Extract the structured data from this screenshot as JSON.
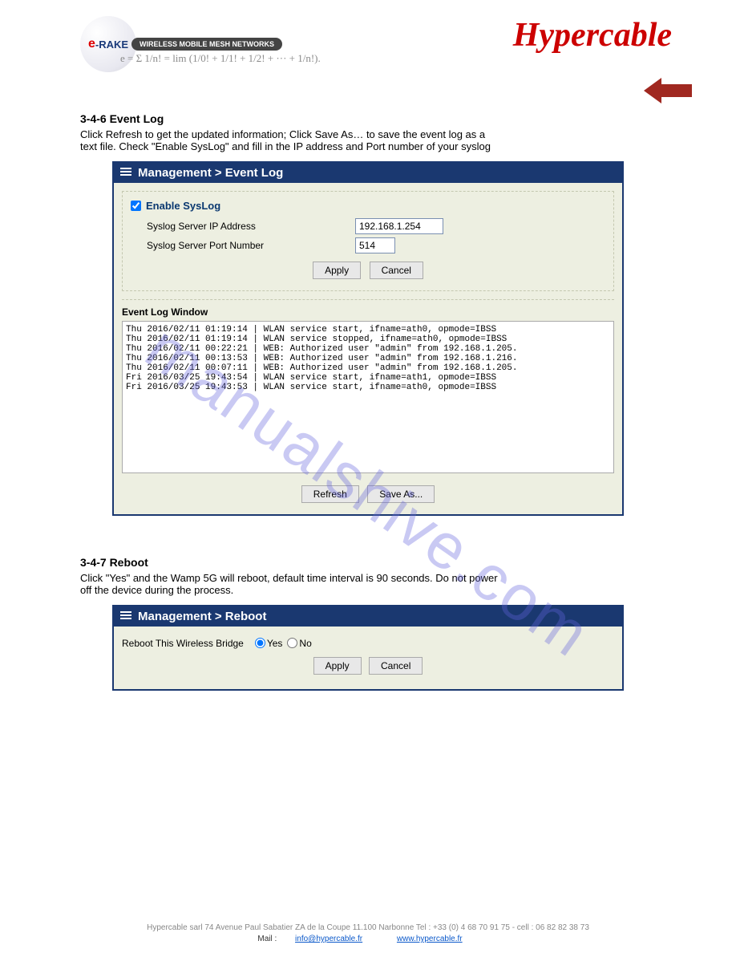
{
  "watermark": "manualshive.com",
  "header": {
    "erake": {
      "e": "e",
      "rake": "-RAKE",
      "tagline": "WIRELESS MOBILE MESH NETWORKS"
    },
    "formula": "e = Σ 1/n! = lim (1/0! + 1/1! + 1/2! + ··· + 1/n!).",
    "hypercable": "Hypercable"
  },
  "sections": {
    "event_log": {
      "heading": "3-4-6 Event Log",
      "desc1": "Click Refresh to get the updated information; Click Save As… to save the event log as a",
      "desc2": "text file. Check \"Enable SysLog\" and fill in the IP address and Port number of your syslog"
    },
    "reboot": {
      "heading": "3-4-7 Reboot",
      "desc1": "Click \"Yes\" and the Wamp 5G will reboot, default time interval is 90 seconds. Do not power",
      "desc2": "off the device during the process."
    }
  },
  "panels": {
    "event_log": {
      "title": "Management > Event Log",
      "enable_label": "Enable SysLog",
      "ip_label": "Syslog Server IP Address",
      "ip_value": "192.168.1.254",
      "port_label": "Syslog Server Port Number",
      "port_value": "514",
      "window_label": "Event Log Window",
      "log_text": "Thu 2016/02/11 01:19:14 | WLAN service start, ifname=ath0, opmode=IBSS\nThu 2016/02/11 01:19:14 | WLAN service stopped, ifname=ath0, opmode=IBSS\nThu 2016/02/11 00:22:21 | WEB: Authorized user \"admin\" from 192.168.1.205.\nThu 2016/02/11 00:13:53 | WEB: Authorized user \"admin\" from 192.168.1.216.\nThu 2016/02/11 00:07:11 | WEB: Authorized user \"admin\" from 192.168.1.205.\nFri 2016/03/25 19:43:54 | WLAN service start, ifname=ath1, opmode=IBSS\nFri 2016/03/25 19:43:53 | WLAN service start, ifname=ath0, opmode=IBSS"
    },
    "reboot": {
      "title": "Management > Reboot",
      "question": "Reboot This Wireless Bridge",
      "yes": "Yes",
      "no": "No"
    }
  },
  "buttons": {
    "apply": "Apply",
    "cancel": "Cancel",
    "refresh": "Refresh",
    "save_as": "Save As..."
  },
  "footer": {
    "line1": "Hypercable sarl 74 Avenue Paul Sabatier ZA de la Coupe 11.100 Narbonne Tel : +33 (0) 4 68 70 91 75 - cell : 06 82 82 38 73",
    "lang": "Mail :",
    "link1": "info@hypercable.fr",
    "link2": "www.hypercable.fr"
  }
}
